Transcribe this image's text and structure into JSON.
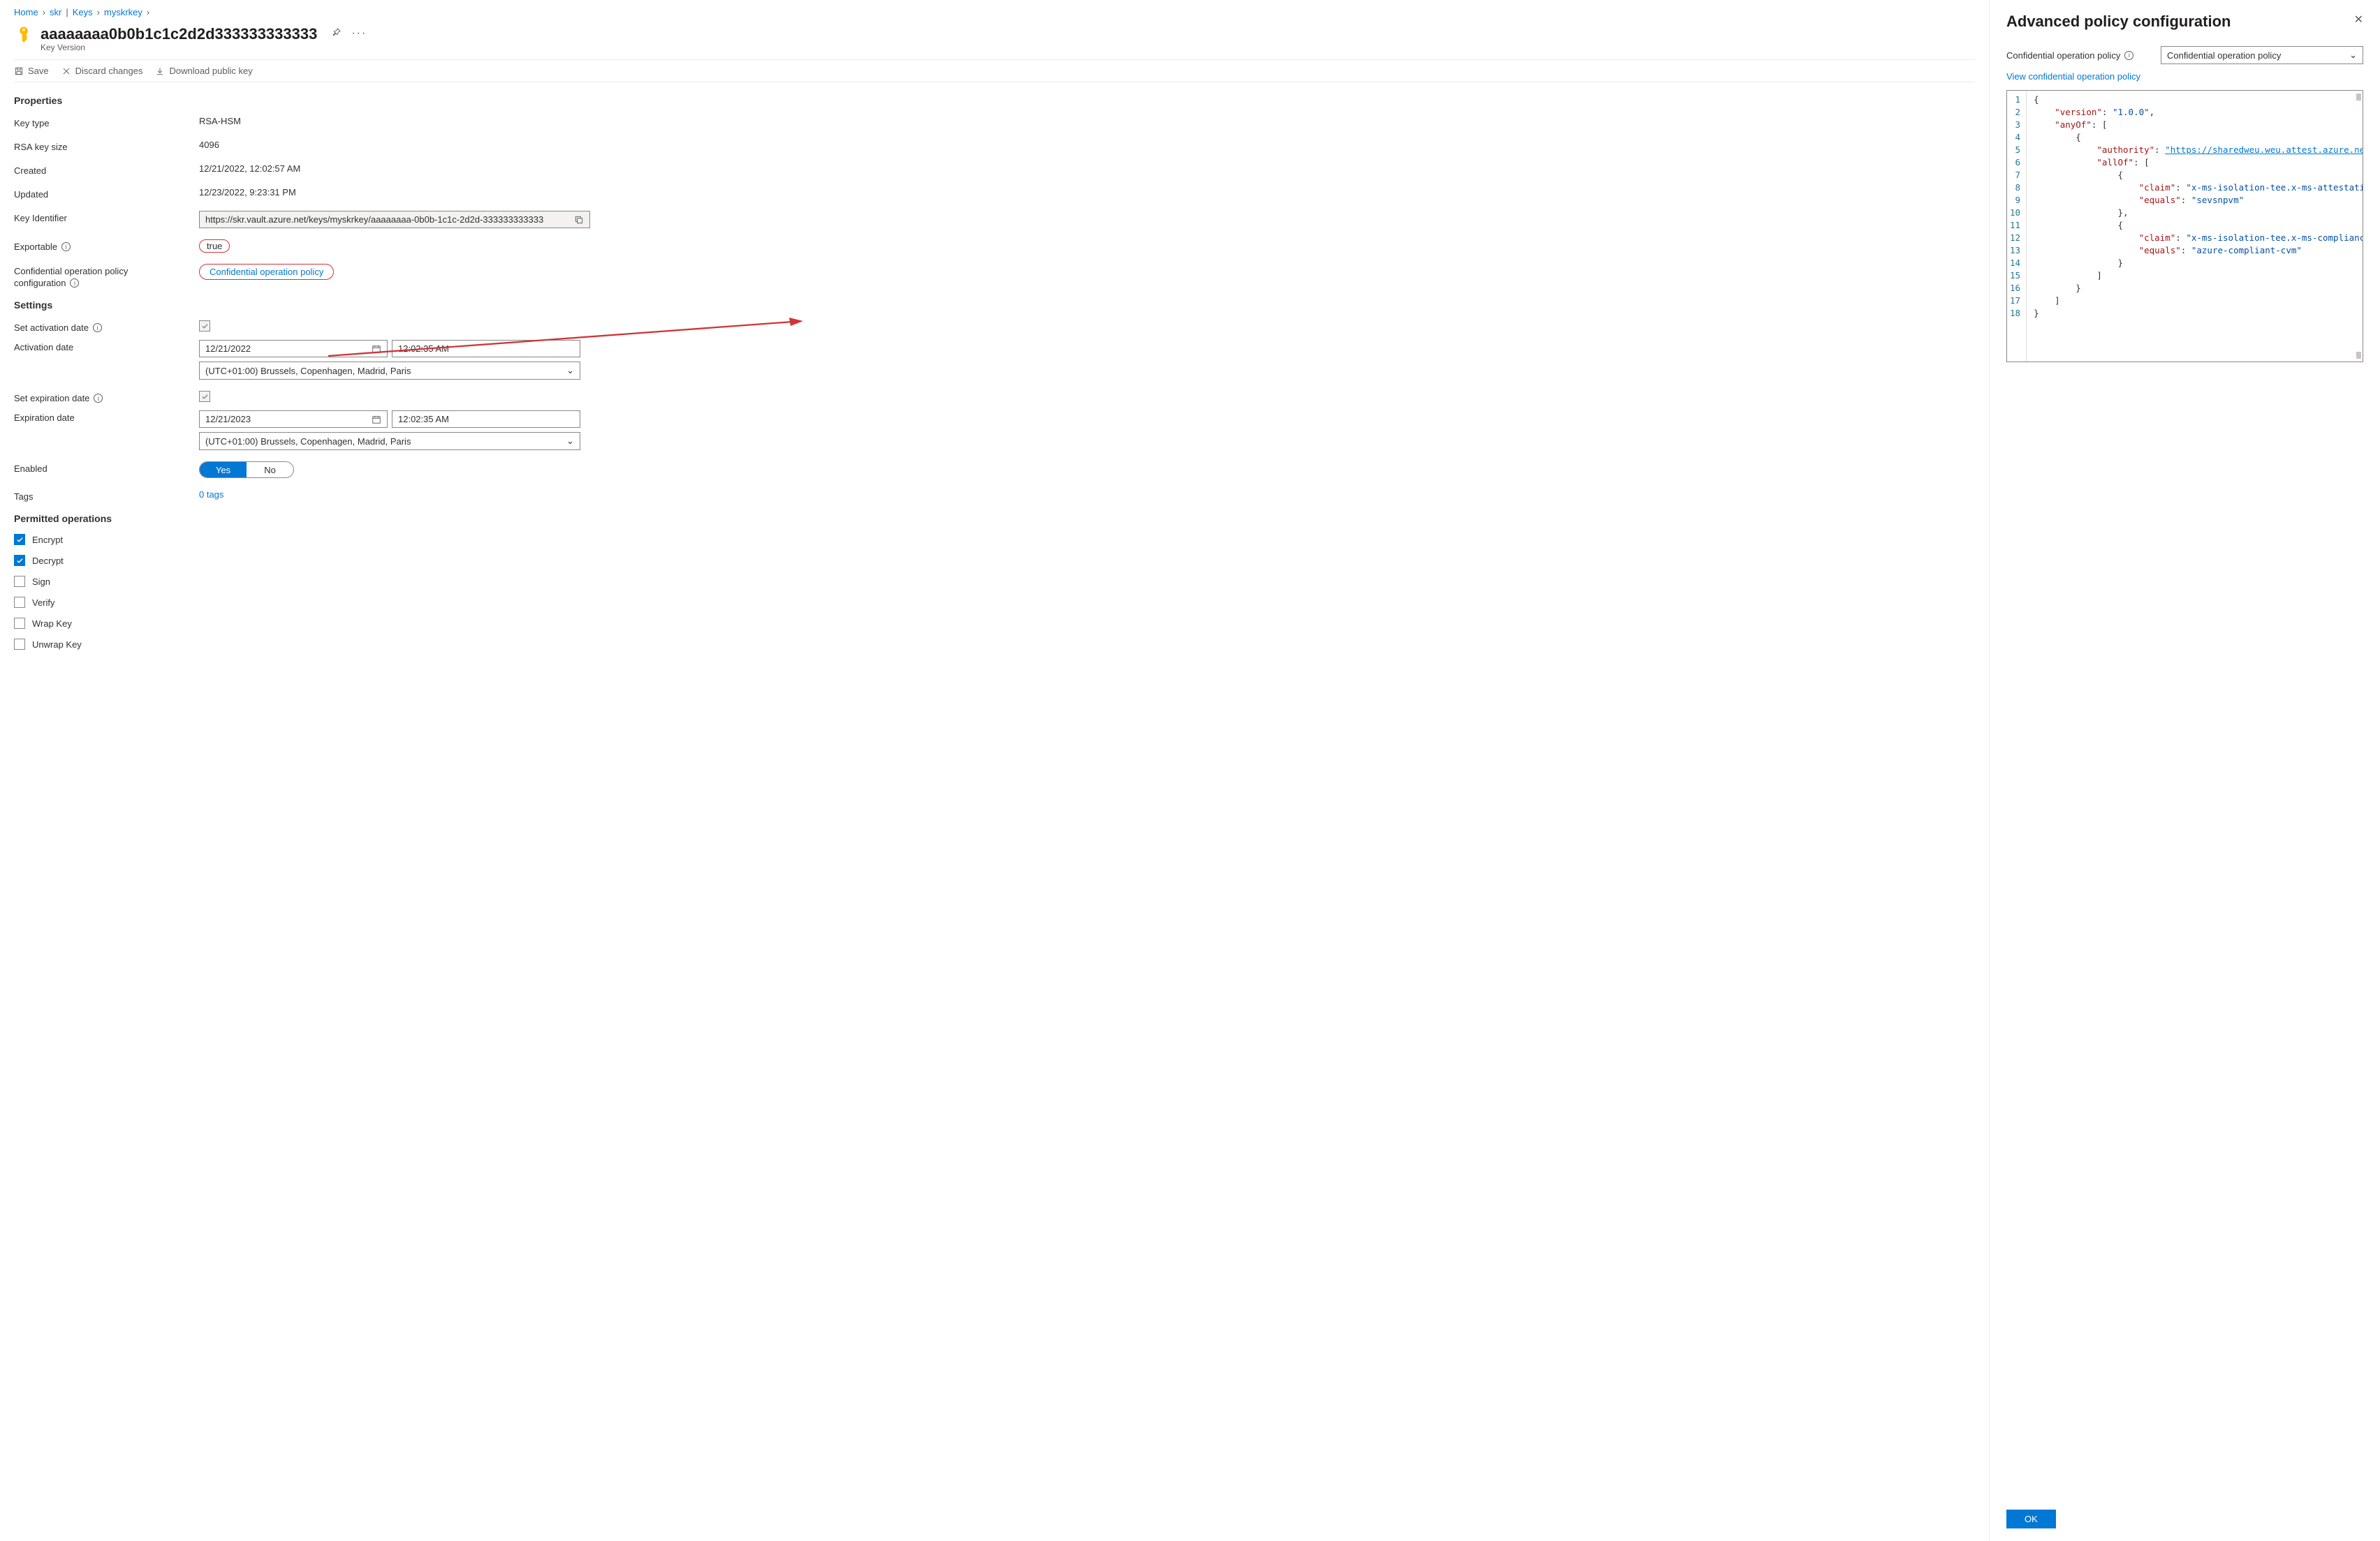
{
  "breadcrumb": {
    "home": "Home",
    "skr": "skr",
    "keys": "Keys",
    "myskrkey": "myskrkey"
  },
  "header": {
    "title": "aaaaaaaa0b0b1c1c2d2d333333333333",
    "subtitle": "Key Version"
  },
  "toolbar": {
    "save": "Save",
    "discard": "Discard changes",
    "download": "Download public key"
  },
  "sections": {
    "properties": "Properties",
    "settings": "Settings",
    "permitted": "Permitted operations"
  },
  "props": {
    "key_type_label": "Key type",
    "key_type_value": "RSA-HSM",
    "rsa_size_label": "RSA key size",
    "rsa_size_value": "4096",
    "created_label": "Created",
    "created_value": "12/21/2022, 12:02:57 AM",
    "updated_label": "Updated",
    "updated_value": "12/23/2022, 9:23:31 PM",
    "key_id_label": "Key Identifier",
    "key_id_value": "https://skr.vault.azure.net/keys/myskrkey/aaaaaaaa-0b0b-1c1c-2d2d-333333333333",
    "exportable_label": "Exportable",
    "exportable_value": "true",
    "policy_label_1": "Confidential operation policy",
    "policy_label_2": "configuration",
    "policy_link": "Confidential operation policy"
  },
  "settings": {
    "set_activation_label": "Set activation date",
    "activation_date_label": "Activation date",
    "activation_date": "12/21/2022",
    "activation_time": "12:02:35 AM",
    "activation_tz": "(UTC+01:00) Brussels, Copenhagen, Madrid, Paris",
    "set_expiration_label": "Set expiration date",
    "expiration_date_label": "Expiration date",
    "expiration_date": "12/21/2023",
    "expiration_time": "12:02:35 AM",
    "expiration_tz": "(UTC+01:00) Brussels, Copenhagen, Madrid, Paris",
    "enabled_label": "Enabled",
    "enabled_yes": "Yes",
    "enabled_no": "No",
    "tags_label": "Tags",
    "tags_value": "0 tags"
  },
  "ops": {
    "encrypt": "Encrypt",
    "decrypt": "Decrypt",
    "sign": "Sign",
    "verify": "Verify",
    "wrap": "Wrap Key",
    "unwrap": "Unwrap Key"
  },
  "panel": {
    "title": "Advanced policy configuration",
    "label": "Confidential operation policy",
    "select_value": "Confidential operation policy",
    "view_link": "View confidential operation policy",
    "ok": "OK",
    "code": {
      "l1": "{",
      "l2a": "\"version\"",
      "l2b": ": ",
      "l2c": "\"1.0.0\"",
      "l2d": ",",
      "l3a": "\"anyOf\"",
      "l3b": ": [",
      "l4": "{",
      "l5a": "\"authority\"",
      "l5b": ": ",
      "l5c": "\"https://sharedweu.weu.attest.azure.net\"",
      "l5d": ",",
      "l6a": "\"allOf\"",
      "l6b": ": [",
      "l7": "{",
      "l8a": "\"claim\"",
      "l8b": ": ",
      "l8c": "\"x-ms-isolation-tee.x-ms-attestation-t",
      "l9a": "\"equals\"",
      "l9b": ": ",
      "l9c": "\"sevsnpvm\"",
      "l10": "},",
      "l11": "{",
      "l12a": "\"claim\"",
      "l12b": ": ",
      "l12c": "\"x-ms-isolation-tee.x-ms-compliance-st",
      "l13a": "\"equals\"",
      "l13b": ": ",
      "l13c": "\"azure-compliant-cvm\"",
      "l14": "}",
      "l15": "]",
      "l16": "}",
      "l17": "]",
      "l18": "}"
    }
  }
}
